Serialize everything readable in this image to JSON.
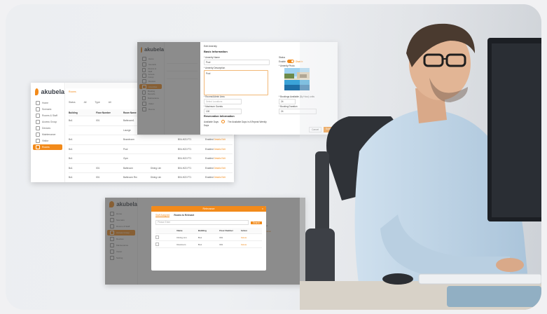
{
  "brand": {
    "name": "akubela",
    "accent": "#f28a1a"
  },
  "left_shot": {
    "nav": [
      "Home",
      "Scenario",
      "Rooms & Staff",
      "Access Group",
      "Devices",
      "Maintenance",
      "Visitor",
      "Rooms"
    ],
    "active_index": 7,
    "crumb": "Rooms",
    "filters": [
      "Status",
      "All",
      "Type",
      "All"
    ],
    "headers": [
      "Building",
      "Floor Number",
      "Room Name",
      "",
      "",
      ""
    ],
    "rows": [
      [
        "Bo1",
        "001",
        "Bathroom1",
        "",
        "",
        "Enabled"
      ],
      [
        "",
        "",
        "Lounge",
        "",
        "",
        "Enabled"
      ],
      [
        "Bo1",
        "",
        "Boardroom",
        "",
        "B04-H22-F71",
        "Enabled"
      ],
      [
        "Bo1",
        "",
        "Pool",
        "",
        "B04-H22-F71",
        "Enabled"
      ],
      [
        "Bo1",
        "",
        "Gym",
        "",
        "B04-H22-F71",
        "Enabled"
      ],
      [
        "Bo1",
        "001",
        "Bathroom",
        "Dining Lim",
        "B04-H22-F71",
        "Enabled"
      ],
      [
        "Bo1",
        "001",
        "Bathroom Rm",
        "Dining Lim",
        "B04-H22-F71",
        "Enabled"
      ]
    ],
    "link_labels": [
      "Details",
      "Edit"
    ]
  },
  "top_shot": {
    "title": "Edit Amenity",
    "section1": "Basic Information",
    "labels": [
      "* Amenity Name",
      "* Amenity Description",
      "Status",
      "* Amenity Photo",
      "* Rooms/Admin Area",
      "* Maximum Guests",
      "* Bookings Available (By Hour) units",
      "* Booking Duration"
    ],
    "name_value": "Pool",
    "desc_value": "Pool",
    "status_text": "Enable",
    "status_off": "Disable",
    "area_placeholder": "Select Locations",
    "guests_value": "100",
    "booking_value": "24",
    "duration_value": "24",
    "section2": "Reservation Information",
    "avail_label": "Available Days",
    "avail_value": "The Available Days in A Repeat Weekly",
    "days_label": "Days",
    "cancel": "Cancel",
    "submit": "Submit",
    "bg_nav": [
      "Home",
      "Scenario",
      "Rooms & Staff",
      "Access Group",
      "Devices",
      "Amenities",
      "Booking Records",
      "Maintenance",
      "Visitor",
      "Rooms"
    ]
  },
  "bottom_shot": {
    "nav": [
      "Home",
      "Scenario",
      "Rooms & Staff",
      "Access Group",
      "Devices",
      "Maintenance",
      "Visitor",
      "Setting"
    ],
    "modal_title": "Relevance",
    "tabs": [
      "Staff Assigned",
      "Rooms to Relevant"
    ],
    "search_placeholder": "Please Enter",
    "search_btn": "Search",
    "headers": [
      "",
      "Name",
      "Building",
      "Floor Number",
      "Action"
    ],
    "rows": [
      [
        "",
        "Dining Lim",
        "Bo1",
        "001",
        "Delete"
      ],
      [
        "",
        "Restroom",
        "Bo1",
        "001",
        "Delete"
      ]
    ],
    "side_right": [
      "Action",
      "Operation"
    ]
  },
  "colors": {
    "accent": "#f28a1a",
    "pool": "#3aa3d8",
    "pool_deep": "#1f6fa6"
  }
}
